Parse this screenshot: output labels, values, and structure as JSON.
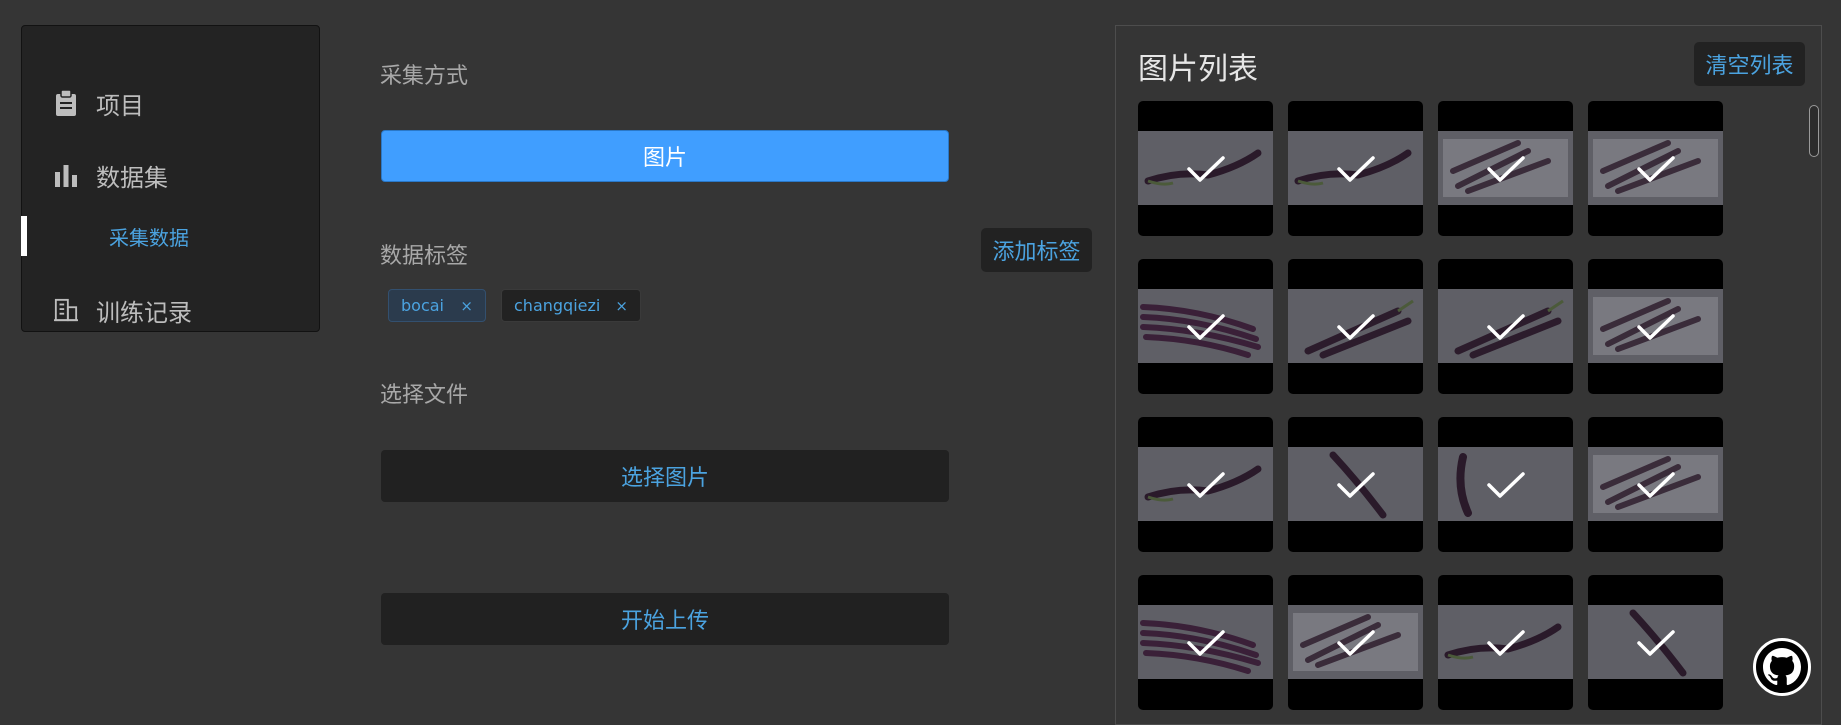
{
  "sidebar": {
    "items": [
      {
        "label": "项目",
        "icon": "clipboard-icon"
      },
      {
        "label": "数据集",
        "icon": "bar-chart-icon"
      },
      {
        "label": "采集数据",
        "active": true
      },
      {
        "label": "训练记录",
        "icon": "building-icon"
      }
    ]
  },
  "form": {
    "collect_method_label": "采集方式",
    "collect_method_button": "图片",
    "data_tags_label": "数据标签",
    "add_tag_button": "添加标签",
    "tags": [
      {
        "text": "bocai",
        "close": "×"
      },
      {
        "text": "changqiezi",
        "close": "×"
      }
    ],
    "select_file_label": "选择文件",
    "select_image_button": "选择图片",
    "start_upload_button": "开始上传"
  },
  "image_list": {
    "title": "图片列表",
    "clear_button": "清空列表",
    "thumbnails": [
      {
        "variant": "single",
        "selected": true
      },
      {
        "variant": "single",
        "selected": true
      },
      {
        "variant": "bag",
        "selected": true
      },
      {
        "variant": "bag",
        "selected": true
      },
      {
        "variant": "bunch",
        "selected": true
      },
      {
        "variant": "pair",
        "selected": true
      },
      {
        "variant": "pair",
        "selected": true
      },
      {
        "variant": "bag",
        "selected": true
      },
      {
        "variant": "single",
        "selected": true
      },
      {
        "variant": "diagonal",
        "selected": true
      },
      {
        "variant": "curve",
        "selected": true
      },
      {
        "variant": "bag",
        "selected": true
      },
      {
        "variant": "bunch",
        "selected": true
      },
      {
        "variant": "bag",
        "selected": true
      },
      {
        "variant": "single",
        "selected": true
      },
      {
        "variant": "diagonal",
        "selected": true
      }
    ]
  },
  "colors": {
    "accent": "#409eff",
    "link": "#4ba3e0",
    "background": "#353535",
    "sidebar": "#232323"
  },
  "github_icon": "github-icon"
}
